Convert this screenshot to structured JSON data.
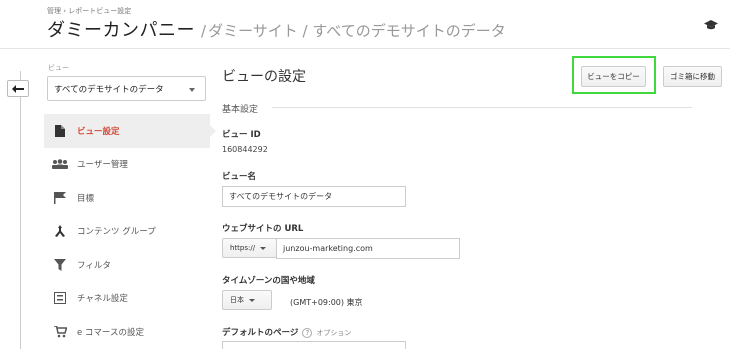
{
  "header": {
    "breadcrumb": "管理 › レポートビュー設定",
    "company": "ダミーカンパニー",
    "separator": "/",
    "site_path": "ダミーサイト / すべてのデモサイトのデータ"
  },
  "sidebar": {
    "view_label": "ビュー",
    "selected_view": "すべてのデモサイトのデータ",
    "items": [
      {
        "label": "ビュー設定",
        "icon": "document-icon",
        "active": true
      },
      {
        "label": "ユーザー管理",
        "icon": "users-icon",
        "active": false
      },
      {
        "label": "目標",
        "icon": "flag-icon",
        "active": false
      },
      {
        "label": "コンテンツ グループ",
        "icon": "content-group-icon",
        "active": false
      },
      {
        "label": "フィルタ",
        "icon": "filter-icon",
        "active": false
      },
      {
        "label": "チャネル設定",
        "icon": "channel-icon",
        "active": false
      },
      {
        "label": "e コマースの設定",
        "icon": "cart-icon",
        "active": false
      }
    ]
  },
  "main": {
    "title": "ビューの設定",
    "copy_button": "ビューをコピー",
    "trash_button": "ゴミ箱に移動",
    "section_title": "基本設定",
    "view_id_label": "ビュー ID",
    "view_id_value": "160844292",
    "view_name_label": "ビュー名",
    "view_name_value": "すべてのデモサイトのデータ",
    "website_url_label": "ウェブサイトの URL",
    "protocol": "https://",
    "url_value": "junzou-marketing.com",
    "timezone_label": "タイムゾーンの国や地域",
    "country": "日本",
    "timezone": "(GMT+09:00) 東京",
    "default_page_label": "デフォルトのページ",
    "help_glyph": "?",
    "optional": "オプション"
  },
  "colors": {
    "accent_active": "#d34836",
    "highlight_box": "#3fd83f"
  }
}
